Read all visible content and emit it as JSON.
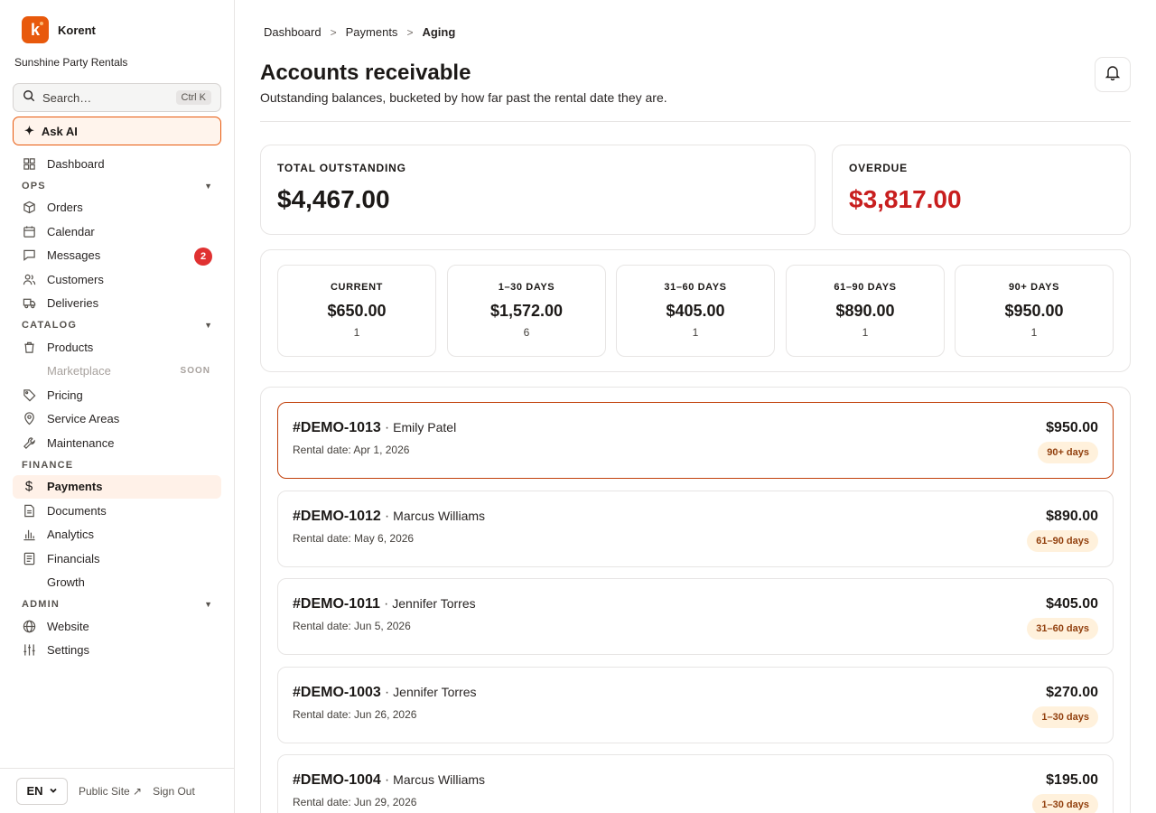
{
  "brand": {
    "name": "Korent",
    "logo_letter": "k",
    "accent": "#e8590c"
  },
  "organization": "Sunshine Party Rentals",
  "search": {
    "label": "Search…",
    "shortcut": "Ctrl K"
  },
  "ask_ai": {
    "label": "Ask AI"
  },
  "nav": {
    "dashboard": "Dashboard",
    "sections": {
      "ops": "OPS",
      "catalog": "CATALOG",
      "finance": "FINANCE",
      "admin": "ADMIN"
    },
    "ops_items": [
      "Orders",
      "Calendar",
      "Messages",
      "Customers",
      "Deliveries"
    ],
    "messages_badge": "2",
    "catalog_items": [
      "Products",
      "Marketplace",
      "Pricing",
      "Service Areas",
      "Maintenance"
    ],
    "marketplace_tag": "SOON",
    "finance_items": [
      "Payments",
      "Documents",
      "Analytics",
      "Financials",
      "Growth"
    ],
    "admin_items": [
      "Website",
      "Settings"
    ]
  },
  "footer": {
    "language": "EN",
    "public_site": "Public Site ↗",
    "sign_out": "Sign Out"
  },
  "breadcrumb": [
    "Dashboard",
    "Payments",
    "Aging"
  ],
  "page": {
    "title": "Accounts receivable",
    "subtitle": "Outstanding balances, bucketed by how far past the rental date they are."
  },
  "summary": {
    "total_label": "TOTAL OUTSTANDING",
    "total_value": "$4,467.00",
    "overdue_label": "OVERDUE",
    "overdue_value": "$3,817.00",
    "overdue_color": "#c81e1e"
  },
  "buckets": [
    {
      "label": "CURRENT",
      "amount": "$650.00",
      "count": "1"
    },
    {
      "label": "1–30 DAYS",
      "amount": "$1,572.00",
      "count": "6"
    },
    {
      "label": "31–60 DAYS",
      "amount": "$405.00",
      "count": "1"
    },
    {
      "label": "61–90 DAYS",
      "amount": "$890.00",
      "count": "1"
    },
    {
      "label": "90+ DAYS",
      "amount": "$950.00",
      "count": "1"
    }
  ],
  "invoices": [
    {
      "id": "#DEMO-1013",
      "customer": "Emily Patel",
      "date": "Rental date: Apr 1, 2026",
      "amount": "$950.00",
      "bucket": "90+ days"
    },
    {
      "id": "#DEMO-1012",
      "customer": "Marcus Williams",
      "date": "Rental date: May 6, 2026",
      "amount": "$890.00",
      "bucket": "61–90 days"
    },
    {
      "id": "#DEMO-1011",
      "customer": "Jennifer Torres",
      "date": "Rental date: Jun 5, 2026",
      "amount": "$405.00",
      "bucket": "31–60 days"
    },
    {
      "id": "#DEMO-1003",
      "customer": "Jennifer Torres",
      "date": "Rental date: Jun 26, 2026",
      "amount": "$270.00",
      "bucket": "1–30 days"
    },
    {
      "id": "#DEMO-1004",
      "customer": "Marcus Williams",
      "date": "Rental date: Jun 29, 2026",
      "amount": "$195.00",
      "bucket": "1–30 days"
    }
  ],
  "separator_dot": "·"
}
